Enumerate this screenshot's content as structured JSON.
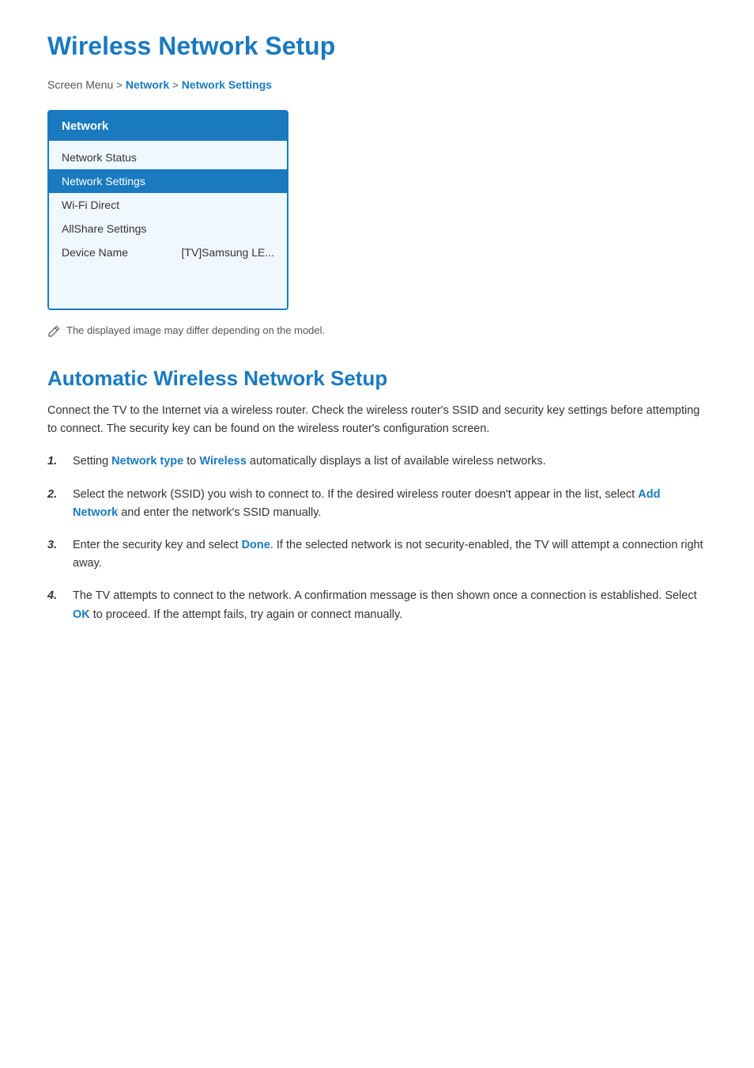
{
  "page": {
    "title": "Wireless Network Setup",
    "breadcrumb": {
      "plain": "Screen Menu",
      "separator1": ">",
      "link1": "Network",
      "separator2": ">",
      "link2": "Network Settings"
    },
    "panel": {
      "header": "Network",
      "items": [
        {
          "label": "Network Status",
          "active": false,
          "value": ""
        },
        {
          "label": "Network Settings",
          "active": true,
          "value": ""
        },
        {
          "label": "Wi-Fi Direct",
          "active": false,
          "value": ""
        },
        {
          "label": "AllShare Settings",
          "active": false,
          "value": ""
        },
        {
          "label": "Device Name",
          "active": false,
          "value": "[TV]Samsung LE..."
        }
      ]
    },
    "note": "The displayed image may differ depending on the model.",
    "section1": {
      "title": "Automatic Wireless Network Setup",
      "intro": "Connect the TV to the Internet via a wireless router. Check the wireless router's SSID and security key settings before attempting to connect. The security key can be found on the wireless router's configuration screen.",
      "steps": [
        {
          "number": "1.",
          "text_before": "Setting ",
          "highlight1": "Network type",
          "text_mid1": " to ",
          "highlight2": "Wireless",
          "text_after": " automatically displays a list of available wireless networks."
        },
        {
          "number": "2.",
          "text_before": "Select the network (SSID) you wish to connect to. If the desired wireless router doesn't appear in the list, select ",
          "highlight1": "Add Network",
          "text_after": " and enter the network's SSID manually."
        },
        {
          "number": "3.",
          "text_before": "Enter the security key and select ",
          "highlight1": "Done",
          "text_after": ". If the selected network is not security-enabled, the TV will attempt a connection right away."
        },
        {
          "number": "4.",
          "text_before": "The TV attempts to connect to the network. A confirmation message is then shown once a connection is established. Select ",
          "highlight1": "OK",
          "text_after": " to proceed. If the attempt fails, try again or connect manually."
        }
      ]
    }
  }
}
